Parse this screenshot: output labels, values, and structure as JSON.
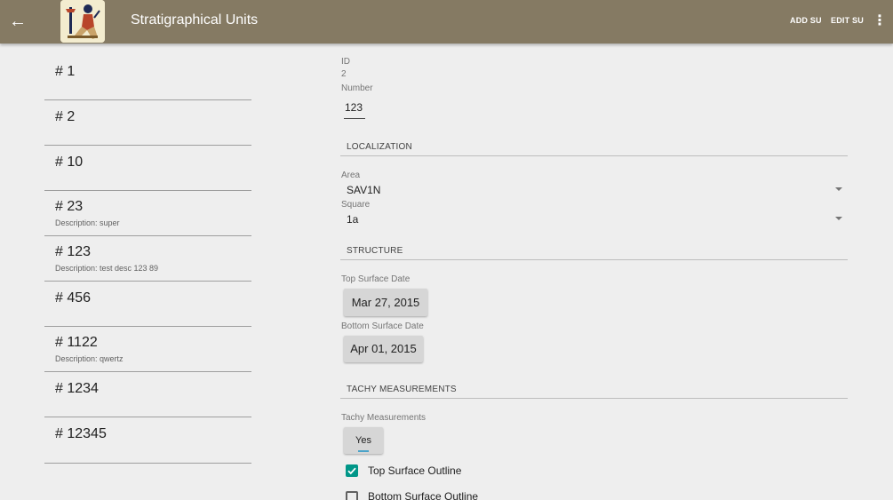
{
  "appbar": {
    "title": "Stratigraphical Units",
    "back_icon": "arrow-left-icon",
    "actions": {
      "add": "ADD SU",
      "edit": "EDIT SU"
    },
    "more_icon": "more-vert-icon",
    "color": "#857a63"
  },
  "list": {
    "items": [
      {
        "number": "# 1",
        "description": ""
      },
      {
        "number": "# 2",
        "description": ""
      },
      {
        "number": "# 10",
        "description": ""
      },
      {
        "number": "# 23",
        "description": "Description: super"
      },
      {
        "number": "# 123",
        "description": "Description: test desc 123 89"
      },
      {
        "number": "# 456",
        "description": ""
      },
      {
        "number": "# 1122",
        "description": "Description: qwertz"
      },
      {
        "number": "# 1234",
        "description": ""
      },
      {
        "number": "# 12345",
        "description": ""
      }
    ]
  },
  "detail": {
    "id_label": "ID",
    "id_value": "2",
    "number_label": "Number",
    "number_value": "123",
    "localization_header": "LOCALIZATION",
    "area_label": "Area",
    "area_value": "SAV1N",
    "square_label": "Square",
    "square_value": "1a",
    "structure_header": "STRUCTURE",
    "top_date_label": "Top Surface Date",
    "top_date_value": "Mar 27, 2015",
    "bottom_date_label": "Bottom Surface Date",
    "bottom_date_value": "Apr 01, 2015",
    "tachy_header": "TACHY MEASUREMENTS",
    "tachy_label": "Tachy Measurements",
    "tachy_toggle": "Yes",
    "top_outline_label": "Top Surface Outline",
    "top_outline_checked": true,
    "bottom_outline_label": "Bottom Surface Outline",
    "bottom_outline_checked": false,
    "accent": "#009688"
  }
}
